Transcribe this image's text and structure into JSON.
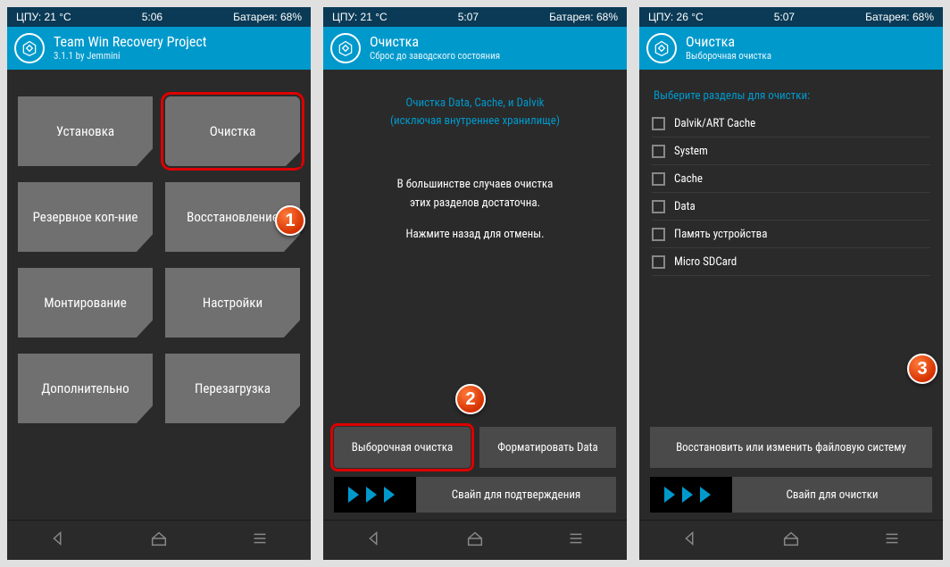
{
  "screens": [
    {
      "status": {
        "cpu": "ЦПУ: 21 °C",
        "time": "5:06",
        "battery": "Батарея: 68%"
      },
      "header": {
        "title": "Team Win Recovery Project",
        "sub": "3.1.1 by Jemmini"
      },
      "tiles": [
        "Установка",
        "Очистка",
        "Резервное коп-ние",
        "Восстановление",
        "Монтирование",
        "Настройки",
        "Дополнительно",
        "Перезагрузка"
      ],
      "badge": "1"
    },
    {
      "status": {
        "cpu": "ЦПУ: 21 °C",
        "time": "5:07",
        "battery": "Батарея: 68%"
      },
      "header": {
        "title": "Очистка",
        "sub": "Сброс до заводского состояния"
      },
      "info_top_1": "Очистка Data, Cache, и Dalvik",
      "info_top_2": "(исключая внутреннее хранилище)",
      "info_mid_1": "В большинстве случаев очистка",
      "info_mid_2": "этих разделов достаточна.",
      "info_mid_3": "Нажмите назад для отмены.",
      "btn_left": "Выборочная очистка",
      "btn_right": "Форматировать Data",
      "swipe": "Свайп для подтверждения",
      "badge": "2"
    },
    {
      "status": {
        "cpu": "ЦПУ: 26 °C",
        "time": "5:07",
        "battery": "Батарея: 68%"
      },
      "header": {
        "title": "Очистка",
        "sub": "Выборочная очистка"
      },
      "section": "Выберите разделы для очистки:",
      "items": [
        "Dalvik/ART Cache",
        "System",
        "Cache",
        "Data",
        "Память устройства",
        "Micro SDCard"
      ],
      "btn": "Восстановить или изменить файловую систему",
      "swipe": "Свайп для очистки",
      "badge": "3"
    }
  ]
}
